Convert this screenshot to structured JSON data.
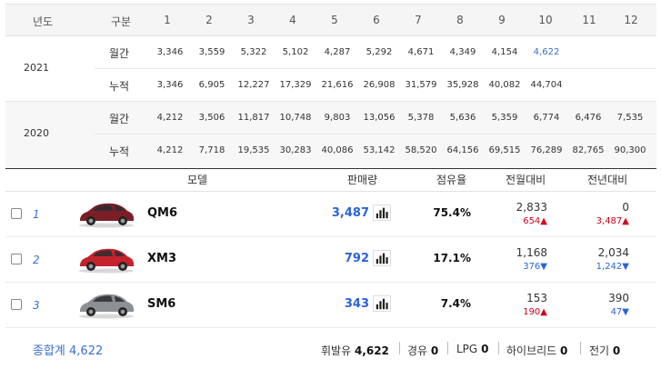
{
  "monthly": {
    "header": {
      "year": "년도",
      "type": "구분",
      "months": [
        "1",
        "2",
        "3",
        "4",
        "5",
        "6",
        "7",
        "8",
        "9",
        "10",
        "11",
        "12"
      ]
    },
    "years": [
      {
        "year": "2021",
        "rows": [
          {
            "type": "월간",
            "values": [
              "3,346",
              "3,559",
              "5,322",
              "5,102",
              "4,287",
              "5,292",
              "4,671",
              "4,349",
              "4,154",
              "4,622",
              "",
              ""
            ]
          },
          {
            "type": "누적",
            "values": [
              "3,346",
              "6,905",
              "12,227",
              "17,329",
              "21,616",
              "26,908",
              "31,579",
              "35,928",
              "40,082",
              "44,704",
              "",
              ""
            ]
          }
        ]
      },
      {
        "year": "2020",
        "rows": [
          {
            "type": "월간",
            "values": [
              "4,212",
              "3,506",
              "11,817",
              "10,748",
              "9,803",
              "13,056",
              "5,378",
              "5,636",
              "5,359",
              "6,774",
              "6,476",
              "7,535"
            ]
          },
          {
            "type": "누적",
            "values": [
              "4,212",
              "7,718",
              "19,535",
              "30,283",
              "40,086",
              "53,142",
              "58,520",
              "64,156",
              "69,515",
              "76,289",
              "82,765",
              "90,300"
            ]
          }
        ]
      }
    ]
  },
  "ranking": {
    "header": {
      "model": "모델",
      "sales": "판매량",
      "share": "점유율",
      "mom": "전월대비",
      "yoy": "전년대비"
    },
    "rows": [
      {
        "rank": "1",
        "model": "QM6",
        "sales": "3,487",
        "share": "75.4%",
        "mom_value": "2,833",
        "mom_delta": "654",
        "mom_dir": "up",
        "yoy_value": "0",
        "yoy_delta": "3,487",
        "yoy_dir": "up",
        "car_color": "#7a1f27"
      },
      {
        "rank": "2",
        "model": "XM3",
        "sales": "792",
        "share": "17.1%",
        "mom_value": "1,168",
        "mom_delta": "376",
        "mom_dir": "down",
        "yoy_value": "2,034",
        "yoy_delta": "1,242",
        "yoy_dir": "down",
        "car_color": "#c4232b"
      },
      {
        "rank": "3",
        "model": "SM6",
        "sales": "343",
        "share": "7.4%",
        "mom_value": "153",
        "mom_delta": "190",
        "mom_dir": "up",
        "yoy_value": "390",
        "yoy_delta": "47",
        "yoy_dir": "down",
        "car_color": "#8c8f93"
      }
    ]
  },
  "footer": {
    "total_label": "종합계",
    "total_value": "4,622",
    "fuels": [
      {
        "label": "휘발유",
        "value": "4,622"
      },
      {
        "label": "경유",
        "value": "0"
      },
      {
        "label": "LPG",
        "value": "0"
      },
      {
        "label": "하이브리드",
        "value": "0"
      },
      {
        "label": "전기",
        "value": "0"
      }
    ]
  },
  "colors": {
    "accent": "#2c64d6",
    "up": "#d0021b",
    "down": "#2c64d6"
  },
  "icons": {
    "chart": "bar-chart-icon",
    "up": "up-triangle-icon",
    "down": "down-triangle-icon"
  }
}
